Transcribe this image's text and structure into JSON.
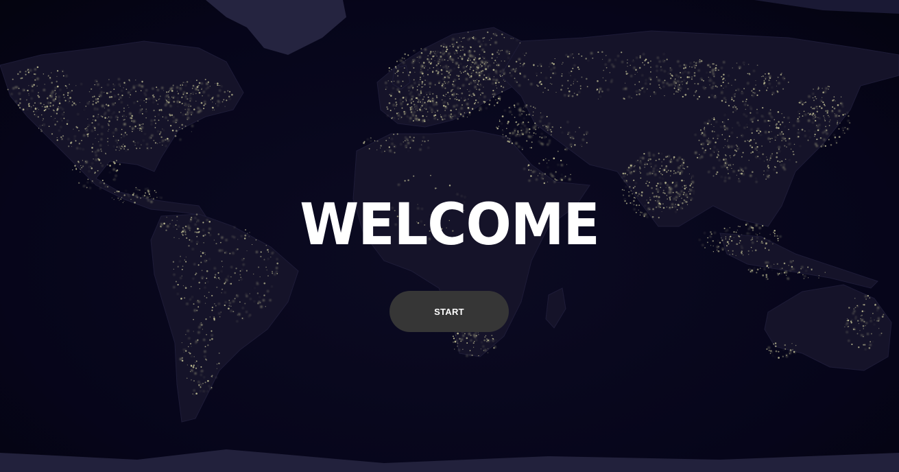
{
  "hero": {
    "title": "WELCOME",
    "start_label": "START"
  },
  "colors": {
    "background": "#07061a",
    "land": "#17152e",
    "city_lights": "#c9c79a",
    "ice": "#2a2944",
    "button": "#363636",
    "text": "#ffffff"
  }
}
